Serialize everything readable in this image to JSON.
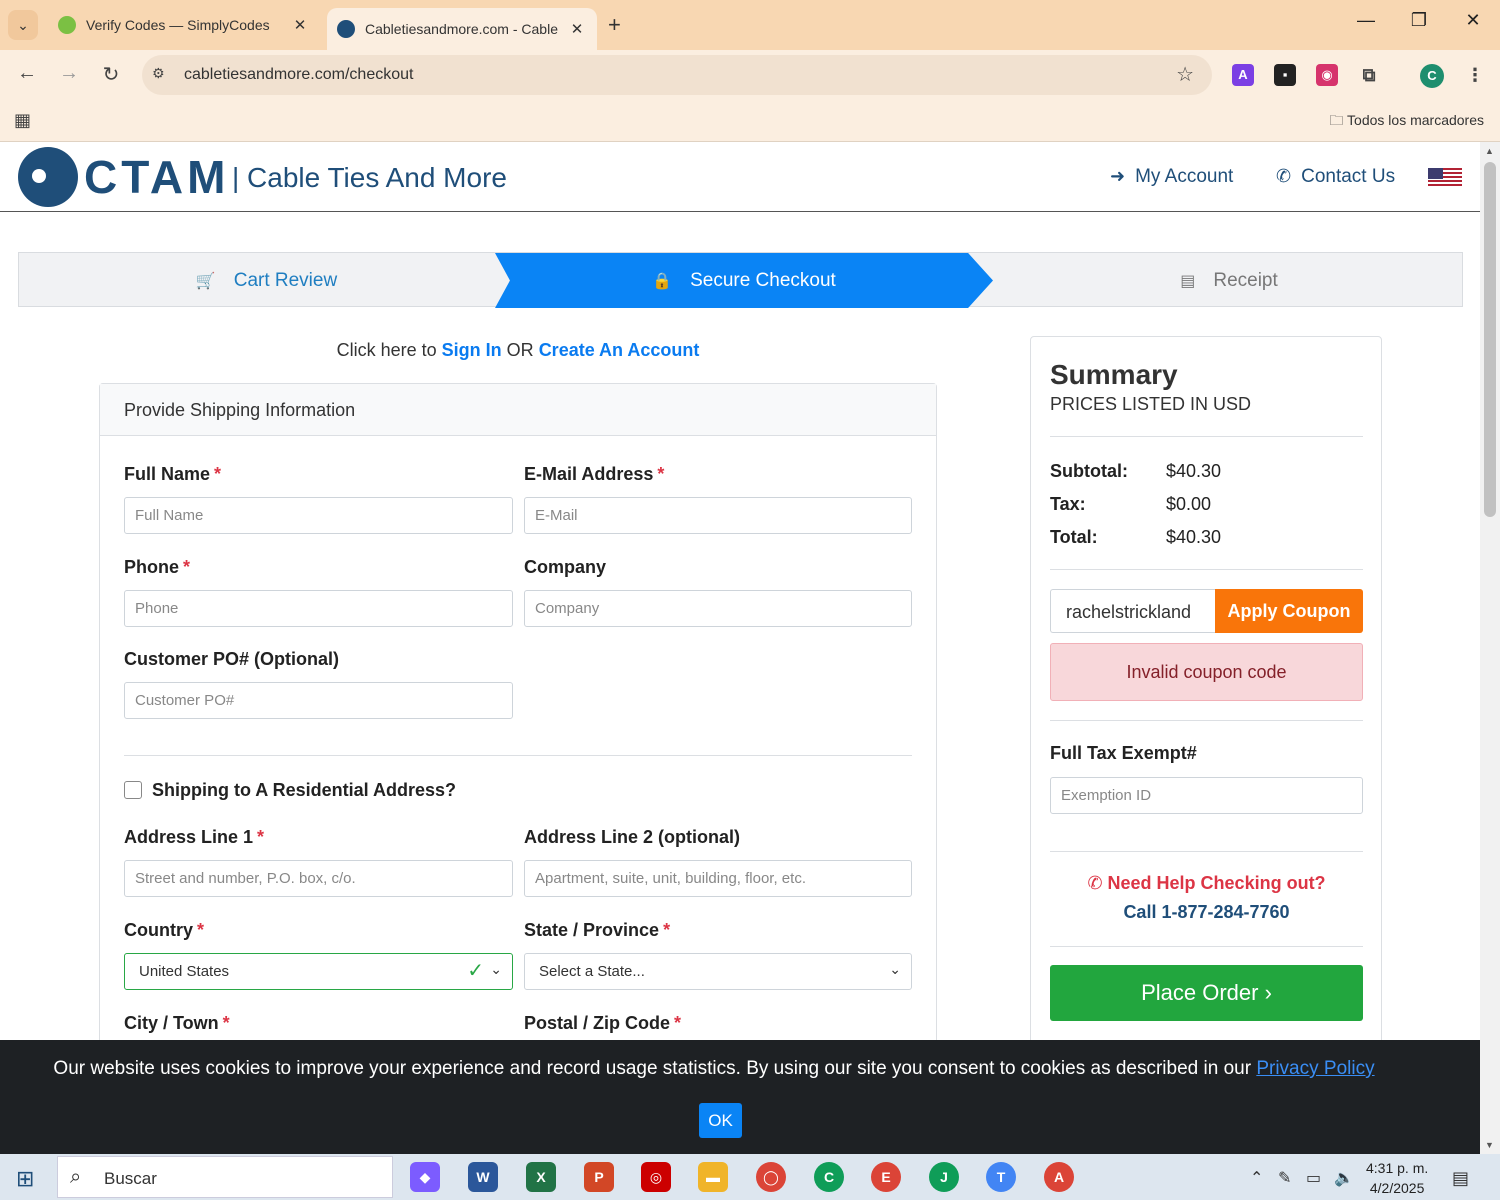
{
  "browser": {
    "tabs": [
      {
        "title": "Verify Codes — SimplyCodes",
        "favicon_color": "#7bc043"
      },
      {
        "title": "Cabletiesandmore.com - Cable",
        "favicon_color": "#1f4e79"
      }
    ],
    "url": "cabletiesandmore.com/checkout",
    "bookmarks_label": "Todos los marcadores",
    "profile_initial": "C"
  },
  "site": {
    "logo_text": "CTAM",
    "logo_sub": "| Cable Ties And More",
    "my_account": "My Account",
    "contact_us": "Contact Us"
  },
  "steps": [
    {
      "label": "Cart Review",
      "icon": "cart-icon",
      "state": "done"
    },
    {
      "label": "Secure Checkout",
      "icon": "lock-icon",
      "state": "active"
    },
    {
      "label": "Receipt",
      "icon": "receipt-icon",
      "state": "pending"
    }
  ],
  "signin": {
    "prefix": "Click here to",
    "signin_link": "Sign In",
    "or": "OR",
    "create_link": "Create An Account"
  },
  "shipping": {
    "header": "Provide Shipping Information",
    "full_name": {
      "label": "Full Name",
      "placeholder": "Full Name"
    },
    "email": {
      "label": "E-Mail Address",
      "placeholder": "E-Mail"
    },
    "phone": {
      "label": "Phone",
      "placeholder": "Phone"
    },
    "company": {
      "label": "Company",
      "placeholder": "Company"
    },
    "po": {
      "label": "Customer PO# (Optional)",
      "placeholder": "Customer PO#"
    },
    "residential": {
      "label": "Shipping to A Residential Address?",
      "checked": false
    },
    "address1": {
      "label": "Address Line 1",
      "placeholder": "Street and number, P.O. box, c/o."
    },
    "address2": {
      "label": "Address Line 2 (optional)",
      "placeholder": "Apartment, suite, unit, building, floor, etc."
    },
    "country": {
      "label": "Country",
      "value": "United States"
    },
    "state": {
      "label": "State / Province",
      "value": "Select a State..."
    },
    "city": {
      "label": "City / Town"
    },
    "postal": {
      "label": "Postal / Zip Code"
    },
    "required_mark": "*"
  },
  "summary": {
    "title": "Summary",
    "subtitle": "PRICES LISTED IN USD",
    "subtotal_label": "Subtotal:",
    "subtotal": "$40.30",
    "tax_label": "Tax:",
    "tax": "$0.00",
    "total_label": "Total:",
    "total": "$40.30",
    "coupon_value": "rachelstrickland",
    "apply_coupon": "Apply Coupon",
    "coupon_error": "Invalid coupon code",
    "tax_exempt_label": "Full Tax Exempt#",
    "tax_exempt_placeholder": "Exemption ID",
    "help_line1": "Need Help Checking out?",
    "help_line2": "Call 1-877-284-7760",
    "place_order": "Place Order"
  },
  "cookie": {
    "text": "Our website uses cookies to improve your experience and record usage statistics. By using our site you consent to cookies as described in our",
    "link": "Privacy Policy",
    "ok": "OK"
  },
  "taskbar": {
    "search": "Buscar",
    "time": "4:31 p. m.",
    "date": "4/2/2025"
  },
  "colors": {
    "brand": "#1f4e79",
    "accent": "#0a84f5",
    "coupon": "#f9750a",
    "success": "#22a63e",
    "danger": "#dc3545"
  }
}
